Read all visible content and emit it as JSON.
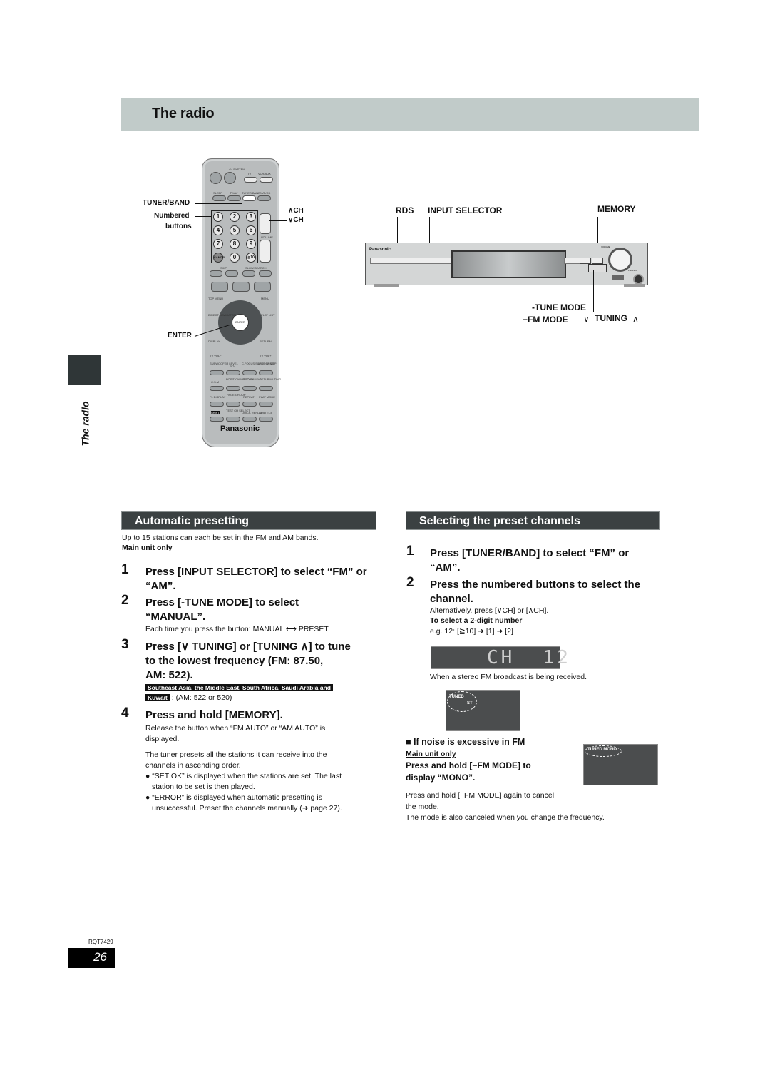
{
  "page": {
    "title": "The radio",
    "side_label": "The radio",
    "doc_code": "RQT7429",
    "page_number": "26"
  },
  "remote_diagram": {
    "brand": "Panasonic",
    "callouts": {
      "tuner_band": "TUNER/BAND",
      "numbered_line1": "Numbered",
      "numbered_line2": "buttons",
      "enter": "ENTER",
      "ch_up": "∧CH",
      "ch_down": "∨CH"
    },
    "button_labels": {
      "av_system": "AV SYSTEM",
      "tv": "TV",
      "vcr_aux": "VCR/AUX",
      "sleep": "SLEEP",
      "tv_av": "TV/AV",
      "tuner_band": "TUNER/BAND",
      "dvd_cd": "DVD/CD",
      "volume": "VOLUME",
      "skip": "SKIP",
      "slow_search": "SLOW/SEARCH",
      "top_menu": "TOP MENU",
      "menu": "MENU",
      "direct_navigator": "DIRECT NAVIGATOR",
      "play_list": "PLAY LIST",
      "enter": "ENTER",
      "display": "DISPLAY",
      "return": "RETURN",
      "tv_vol_minus": "TV VOL−",
      "tv_vol_plus": "TV VOL+",
      "subwoofer": "SUBWOOFER LEVEL",
      "sfc": "SFC",
      "c_focus": "C.FOCUS SUPER SRND",
      "mix_2ch": "MIX 2CH DSP",
      "csm": "C.S.M",
      "position_memory": "POSITION MEMORY",
      "zoom_audio": "ZOOM AUDIO",
      "setup": "SETUP MUTING",
      "fl_display": "FL DISPLAY",
      "page_group": "PAGE GROUP",
      "repeat": "REPEAT",
      "play_mode": "PLAY MODE",
      "shift": "SHIFT",
      "test_ch_select": "TEST CH SELECT",
      "quick_replay": "QUICK REPLAY",
      "subtitle": "SUBTITLE"
    },
    "numbered_buttons": [
      "1",
      "2",
      "3",
      "4",
      "5",
      "6",
      "7",
      "8",
      "9",
      "0",
      "≧10"
    ],
    "cancel_label": "CANCEL"
  },
  "unit_diagram": {
    "brand": "Panasonic",
    "callouts": {
      "rds": "RDS",
      "input_selector": "INPUT SELECTOR",
      "memory": "MEMORY",
      "tune_mode": "-TUNE MODE",
      "fm_mode": "−FM MODE",
      "tuning_down": "∨",
      "tuning": "TUNING",
      "tuning_up": "∧"
    },
    "panel_labels": {
      "volume": "VOLUME",
      "phones": "PHONES"
    }
  },
  "automatic_presetting": {
    "heading": "Automatic presetting",
    "intro": "Up to 15 stations can each be set in the FM and AM bands.",
    "note": "Main unit only",
    "steps": [
      {
        "num": "1",
        "line1": "Press [INPUT SELECTOR] to select “FM” or",
        "line2": "“AM”."
      },
      {
        "num": "2",
        "line1": "Press [-TUNE MODE] to select",
        "line2": "“MANUAL”.",
        "detail": "Each time you press the button: MANUAL ⟷ PRESET"
      },
      {
        "num": "3",
        "line1": "Press [∨ TUNING] or [TUNING ∧] to tune",
        "line2": "to the lowest frequency (FM: 87.50,",
        "line3": "AM: 522).",
        "region_tag1": "Southeast Asia, the Middle East, South Africa, Saudi Arabia and",
        "region_tag2": "Kuwait",
        "region_note": ": (AM: 522 or 520)"
      },
      {
        "num": "4",
        "line1": "Press and hold [MEMORY].",
        "detail1": "Release the button when “FM AUTO” or “AM AUTO” is",
        "detail2": "displayed."
      }
    ],
    "result_line1": "The tuner presets all the stations it can receive into the",
    "result_line2": "channels in ascending order.",
    "bullets": [
      {
        "line1": "“SET OK” is displayed when the stations are set. The last",
        "line2": "station to be set is then played."
      },
      {
        "line1": "“ERROR” is displayed when automatic presetting is",
        "line2": "unsuccessful. Preset the channels manually (➜ page 27)."
      }
    ]
  },
  "selecting_preset": {
    "heading": "Selecting the preset channels",
    "steps": [
      {
        "num": "1",
        "line1": "Press [TUNER/BAND] to select “FM” or",
        "line2": "“AM”."
      },
      {
        "num": "2",
        "line1": "Press the numbered buttons to select the",
        "line2": "channel."
      }
    ],
    "alt_text": "Alternatively, press [∨CH] or [∧CH].",
    "two_digit_heading": "To select a 2-digit number",
    "two_digit_example": "e.g. 12: [≧10] ➜ [1] ➜ [2]",
    "display_text": "CH  12",
    "stereo_note": "When a stereo FM broadcast is being received.",
    "stereo_display": {
      "tuned": "TUNED",
      "st": "ST"
    },
    "noise": {
      "heading": "■ If noise is excessive in FM",
      "note": "Main unit only",
      "instr_line1": "Press and hold [−FM MODE] to",
      "instr_line2": "display “MONO”.",
      "display_label": "TUNED MONO",
      "cancel_line1": "Press and hold [−FM MODE] again to cancel",
      "cancel_line2": "the mode.",
      "cancel_line3": "The mode is also canceled when you change the frequency."
    }
  }
}
